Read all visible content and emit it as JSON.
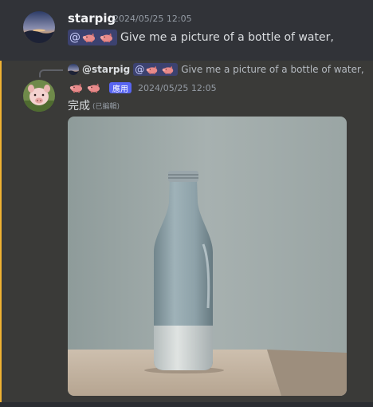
{
  "message1": {
    "username": "starpig",
    "timestamp": "2024/05/25 12:05",
    "mention_symbol": "@",
    "text": "Give me a picture of a bottle of water,"
  },
  "reply": {
    "username": "@starpig",
    "mention_symbol": "@",
    "text": "Give me a picture of a bottle of water,"
  },
  "message2": {
    "app_badge": "應用",
    "timestamp": "2024/05/25 12:05",
    "text": "完成",
    "edited": "(已編輯)"
  },
  "colors": {
    "accent_bar": "#f0b232",
    "mention_bg": "#3c4270",
    "app_badge_bg": "#5865f2"
  },
  "icons": [
    "pig-icon",
    "avatar-sunset",
    "avatar-piglet"
  ]
}
